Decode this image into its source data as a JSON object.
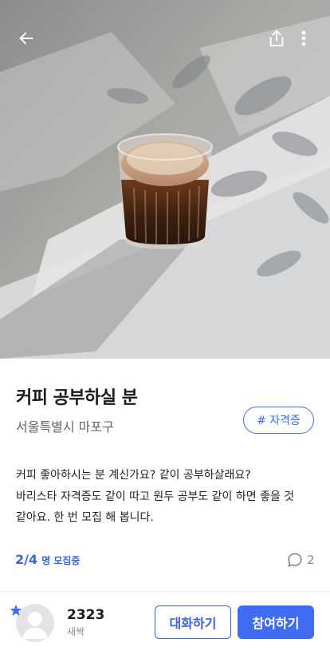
{
  "post": {
    "title": "커피 공부하실 분",
    "location": "서울특별시 마포구",
    "tag": "# 자격증",
    "description": [
      "커피 좋아하시는 분 계신가요? 같이 공부하살래요?",
      "바리스타 자격증도 같이 따고 원두 공부도 같이 하면 좋을 것",
      "같아요. 한 번 모집 해 봅니다."
    ],
    "recruit": {
      "count": "2/4",
      "unit": "명 모집중"
    },
    "comment_count": "2"
  },
  "author": {
    "name": "2323",
    "grade": "새싹"
  },
  "actions": {
    "chat_label": "대화하기",
    "join_label": "참여하기"
  },
  "icons": {
    "back": "arrow-left-icon",
    "share": "share-icon",
    "more": "more-vertical-icon",
    "comment": "comment-icon",
    "star": "star-icon"
  },
  "colors": {
    "accent": "#3f6cf0",
    "accent_text": "#3b63d6",
    "muted": "#888888"
  }
}
